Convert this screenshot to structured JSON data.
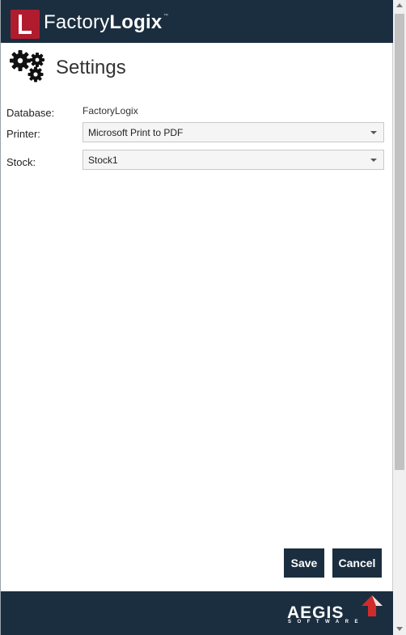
{
  "header": {
    "brand_light": "Factory",
    "brand_bold": "Logix",
    "trademark": "™",
    "bg_color": "#1b2e3f",
    "badge_color": "#b01c2e"
  },
  "page": {
    "title": "Settings",
    "icon": "gears-icon"
  },
  "form": {
    "database": {
      "label": "Database:",
      "value": "FactoryLogix"
    },
    "printer": {
      "label": "Printer:",
      "value": "Microsoft Print to PDF"
    },
    "stock": {
      "label": "Stock:",
      "value": "Stock1"
    }
  },
  "buttons": {
    "save": "Save",
    "cancel": "Cancel"
  },
  "footer": {
    "logo_text": "AEGIS",
    "logo_sub": "SOFTWARE"
  }
}
